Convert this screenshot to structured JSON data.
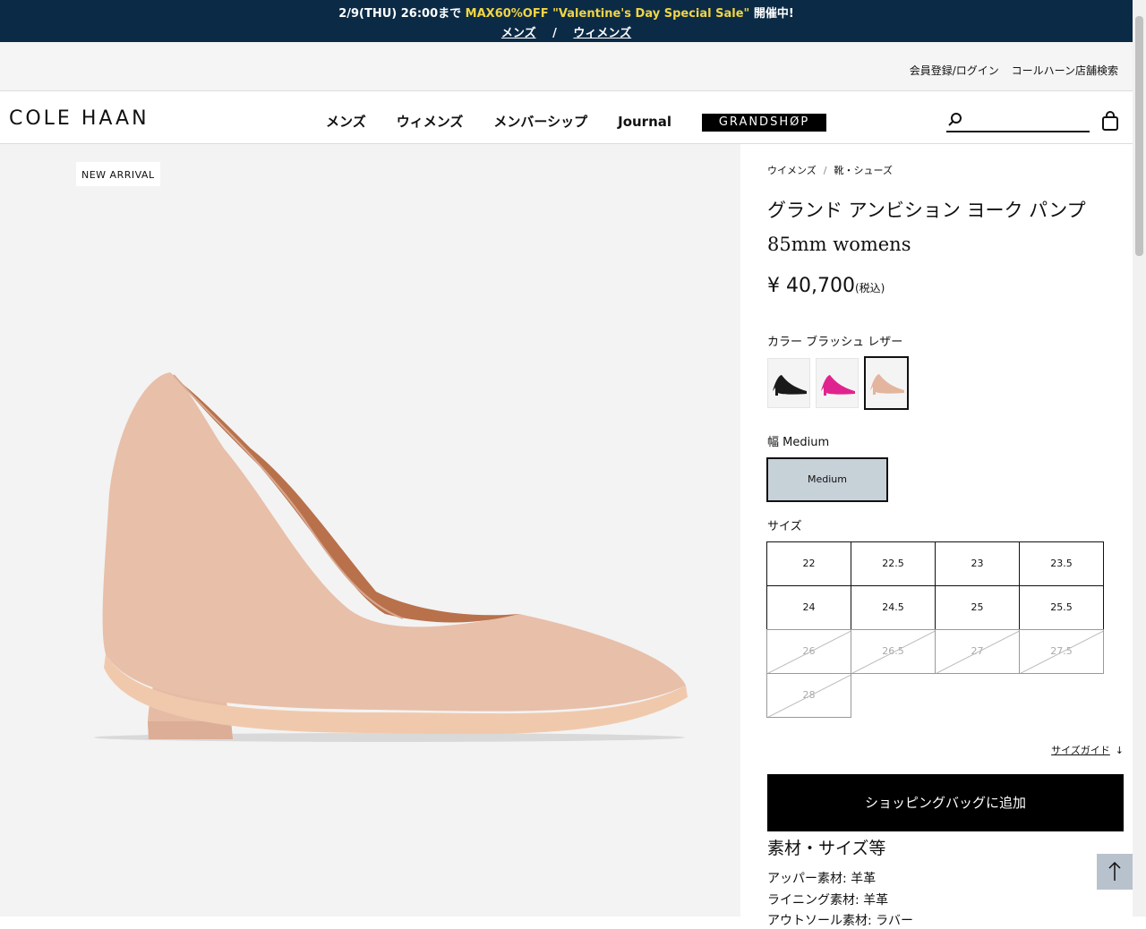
{
  "promo": {
    "prefix": "2/9(THU) 26:00まで",
    "highlight": "MAX60%OFF \"Valentine's Day Special Sale\"",
    "suffix": "開催中!",
    "link_mens": "メンズ",
    "separator": "/",
    "link_womens": "ウィメンズ"
  },
  "utility": {
    "login": "会員登録/ログイン",
    "store_search": "コールハーン店舗検索"
  },
  "header": {
    "logo": "COLE HAAN",
    "nav": [
      "メンズ",
      "ウィメンズ",
      "メンバーシップ",
      "Journal"
    ],
    "grandshop": "GRANDSHØP",
    "search_placeholder": ""
  },
  "product": {
    "badge": "NEW ARRIVAL",
    "breadcrumb": [
      "ウイメンズ",
      "靴・シューズ"
    ],
    "breadcrumb_sep": "/",
    "title_line1": "グランド アンビション ヨーク パンプ",
    "title_line2": "85mm womens",
    "price": "¥ 40,700",
    "price_tax": "(税込)",
    "color_label": "カラー ブラッシュ レザー",
    "colors": [
      {
        "name": "black",
        "hex": "#1a1a1a"
      },
      {
        "name": "pink",
        "hex": "#e0248f"
      },
      {
        "name": "blush",
        "hex": "#e3b59e",
        "selected": true
      }
    ],
    "width_label": "幅 Medium",
    "width_option": "Medium",
    "size_label": "サイズ",
    "sizes": [
      {
        "label": "22",
        "available": true
      },
      {
        "label": "22.5",
        "available": true
      },
      {
        "label": "23",
        "available": true
      },
      {
        "label": "23.5",
        "available": true
      },
      {
        "label": "24",
        "available": true
      },
      {
        "label": "24.5",
        "available": true
      },
      {
        "label": "25",
        "available": true
      },
      {
        "label": "25.5",
        "available": true
      },
      {
        "label": "26",
        "available": false
      },
      {
        "label": "26.5",
        "available": false
      },
      {
        "label": "27",
        "available": false
      },
      {
        "label": "27.5",
        "available": false
      },
      {
        "label": "28",
        "available": false
      }
    ],
    "size_guide": "サイズガイド",
    "add_to_bag": "ショッピングバッグに追加",
    "materials_title": "素材・サイズ等",
    "materials": [
      "アッパー素材: 羊革",
      "ライニング素材: 羊革",
      "アウトソール素材: ラバー"
    ]
  },
  "icons": {
    "search": "search-icon",
    "bag": "shopping-bag-icon",
    "back_to_top": "arrow-up-icon",
    "size_guide_arrow": "arrow-down-icon"
  }
}
